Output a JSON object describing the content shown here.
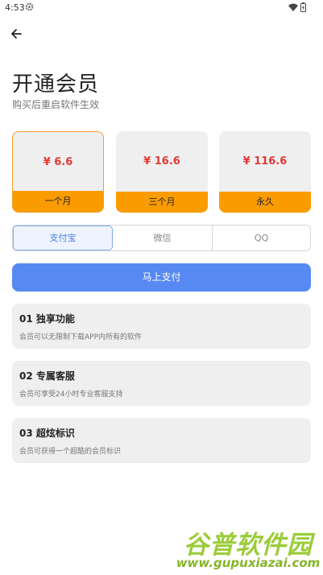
{
  "status_bar": {
    "time": "4:53",
    "icons": [
      "gear-icon",
      "wifi-icon",
      "battery-icon"
    ]
  },
  "header": {
    "back_icon": "arrow-left-icon"
  },
  "title": "开通会员",
  "subtitle": "购买后重启软件生效",
  "plans": [
    {
      "price": "¥ 6.6",
      "label": "一个月",
      "selected": true
    },
    {
      "price": "¥ 16.6",
      "label": "三个月",
      "selected": false
    },
    {
      "price": "¥ 116.6",
      "label": "永久",
      "selected": false
    }
  ],
  "payment_methods": [
    {
      "label": "支付宝",
      "active": true
    },
    {
      "label": "微信",
      "active": false
    },
    {
      "label": "QQ",
      "active": false
    }
  ],
  "pay_button": "马上支付",
  "features": [
    {
      "title": "01 独享功能",
      "desc": "会员可以无限制下载APP内所有的软件"
    },
    {
      "title": "02 专属客服",
      "desc": "会员可享受24小时专业客服支持"
    },
    {
      "title": "03 超炫标识",
      "desc": "会员可获得一个超酷的会员标识"
    }
  ],
  "watermark": {
    "title": "谷普软件园",
    "url": "www.gupuxiazai.com"
  },
  "colors": {
    "accent": "#5789f2",
    "price": "#e53935",
    "plan_bar": "#fa9b00",
    "selected_border": "#f1a02a",
    "watermark": "#9bcc39"
  }
}
